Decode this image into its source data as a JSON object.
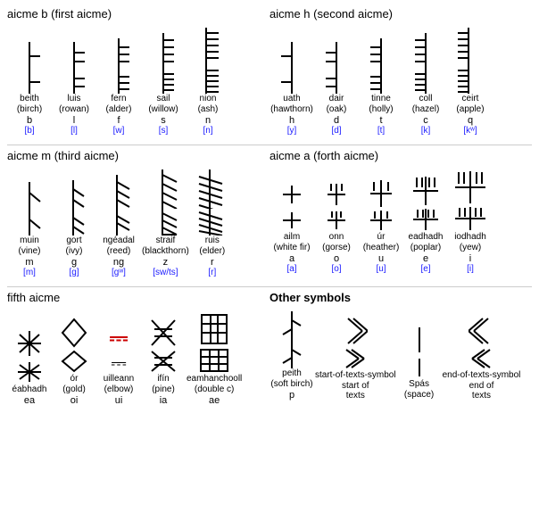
{
  "sections": [
    {
      "id": "aicme-b",
      "title": "aicme b (first aicme)",
      "symbols": [
        {
          "name": "beith\n(birch)",
          "letter": "b",
          "phonetic": "[b]",
          "glyphType": "horizontal-1"
        },
        {
          "name": "luis\n(rowan)",
          "letter": "l",
          "phonetic": "[l]",
          "glyphType": "horizontal-2"
        },
        {
          "name": "fern\n(alder)",
          "letter": "f",
          "phonetic": "[w]",
          "glyphType": "horizontal-3"
        },
        {
          "name": "sail\n(willow)",
          "letter": "s",
          "phonetic": "[s]",
          "glyphType": "horizontal-4"
        },
        {
          "name": "nion\n(ash)",
          "letter": "n",
          "phonetic": "[n]",
          "glyphType": "horizontal-5"
        }
      ]
    },
    {
      "id": "aicme-h",
      "title": "aicme h (second aicme)",
      "symbols": [
        {
          "name": "uath\n(hawthorn)",
          "letter": "h",
          "phonetic": "[y]",
          "glyphType": "right-1"
        },
        {
          "name": "dair\n(oak)",
          "letter": "d",
          "phonetic": "[d]",
          "glyphType": "right-2"
        },
        {
          "name": "tinne\n(holly)",
          "letter": "t",
          "phonetic": "[t]",
          "glyphType": "right-3"
        },
        {
          "name": "coll\n(hazel)",
          "letter": "c",
          "phonetic": "[k]",
          "glyphType": "right-4"
        },
        {
          "name": "ceirt\n(apple)",
          "letter": "q",
          "phonetic": "[kʷ]",
          "glyphType": "right-5"
        }
      ]
    },
    {
      "id": "aicme-m",
      "title": "aicme m (third aicme)",
      "symbols": [
        {
          "name": "muin\n(vine)",
          "letter": "m",
          "phonetic": "[m]",
          "glyphType": "diag-r-1"
        },
        {
          "name": "gort\n(ivy)",
          "letter": "g",
          "phonetic": "[g]",
          "glyphType": "diag-r-2"
        },
        {
          "name": "ngéadal\n(reed)",
          "letter": "ng",
          "phonetic": "[gʷ]",
          "glyphType": "diag-r-3"
        },
        {
          "name": "straif\n(blackthorn)",
          "letter": "z",
          "phonetic": "[sw/ts]",
          "glyphType": "diag-r-4"
        },
        {
          "name": "ruis\n(elder)",
          "letter": "r",
          "phonetic": "[r]",
          "glyphType": "diag-r-5"
        }
      ]
    },
    {
      "id": "aicme-a",
      "title": "aicme a (forth aicme)",
      "symbols": [
        {
          "name": "ailm\n(white fir)",
          "letter": "a",
          "phonetic": "[a]",
          "glyphType": "cross-1"
        },
        {
          "name": "onn\n(gorse)",
          "letter": "o",
          "phonetic": "[o]",
          "glyphType": "cross-2"
        },
        {
          "name": "úr\n(heather)",
          "letter": "u",
          "phonetic": "[u]",
          "glyphType": "cross-3"
        },
        {
          "name": "eadhadh\n(poplar)",
          "letter": "e",
          "phonetic": "[e]",
          "glyphType": "cross-4"
        },
        {
          "name": "iodhadh\n(yew)",
          "letter": "i",
          "phonetic": "[i]",
          "glyphType": "cross-5"
        }
      ]
    },
    {
      "id": "fifth-aicme",
      "title": "fifth aicme",
      "symbols": [
        {
          "name": "éabhadh",
          "letter": "ea",
          "phonetic": "",
          "glyphType": "fifth-1"
        },
        {
          "name": "ór\n(gold)",
          "letter": "oi",
          "phonetic": "",
          "glyphType": "fifth-2"
        },
        {
          "name": "uilleann\n(elbow)",
          "letter": "ui",
          "phonetic": "",
          "glyphType": "fifth-3"
        },
        {
          "name": "ifín\n(pine)",
          "letter": "ia",
          "phonetic": "",
          "glyphType": "fifth-4"
        },
        {
          "name": "eamhanchooll\n(double c)",
          "letter": "ae",
          "phonetic": "",
          "glyphType": "fifth-5"
        }
      ]
    },
    {
      "id": "other-symbols",
      "title": "Other symbols",
      "symbols": [
        {
          "name": "peith\n(soft birch)",
          "letter": "p",
          "phonetic": "",
          "glyphType": "other-1"
        },
        {
          "name": "start of\ntexts",
          "letter": "",
          "phonetic": "",
          "glyphType": "other-2"
        },
        {
          "name": "Spás\n(space)",
          "letter": "",
          "phonetic": "",
          "glyphType": "other-3"
        },
        {
          "name": "end of\ntexts",
          "letter": "",
          "phonetic": "",
          "glyphType": "other-4"
        }
      ]
    }
  ]
}
